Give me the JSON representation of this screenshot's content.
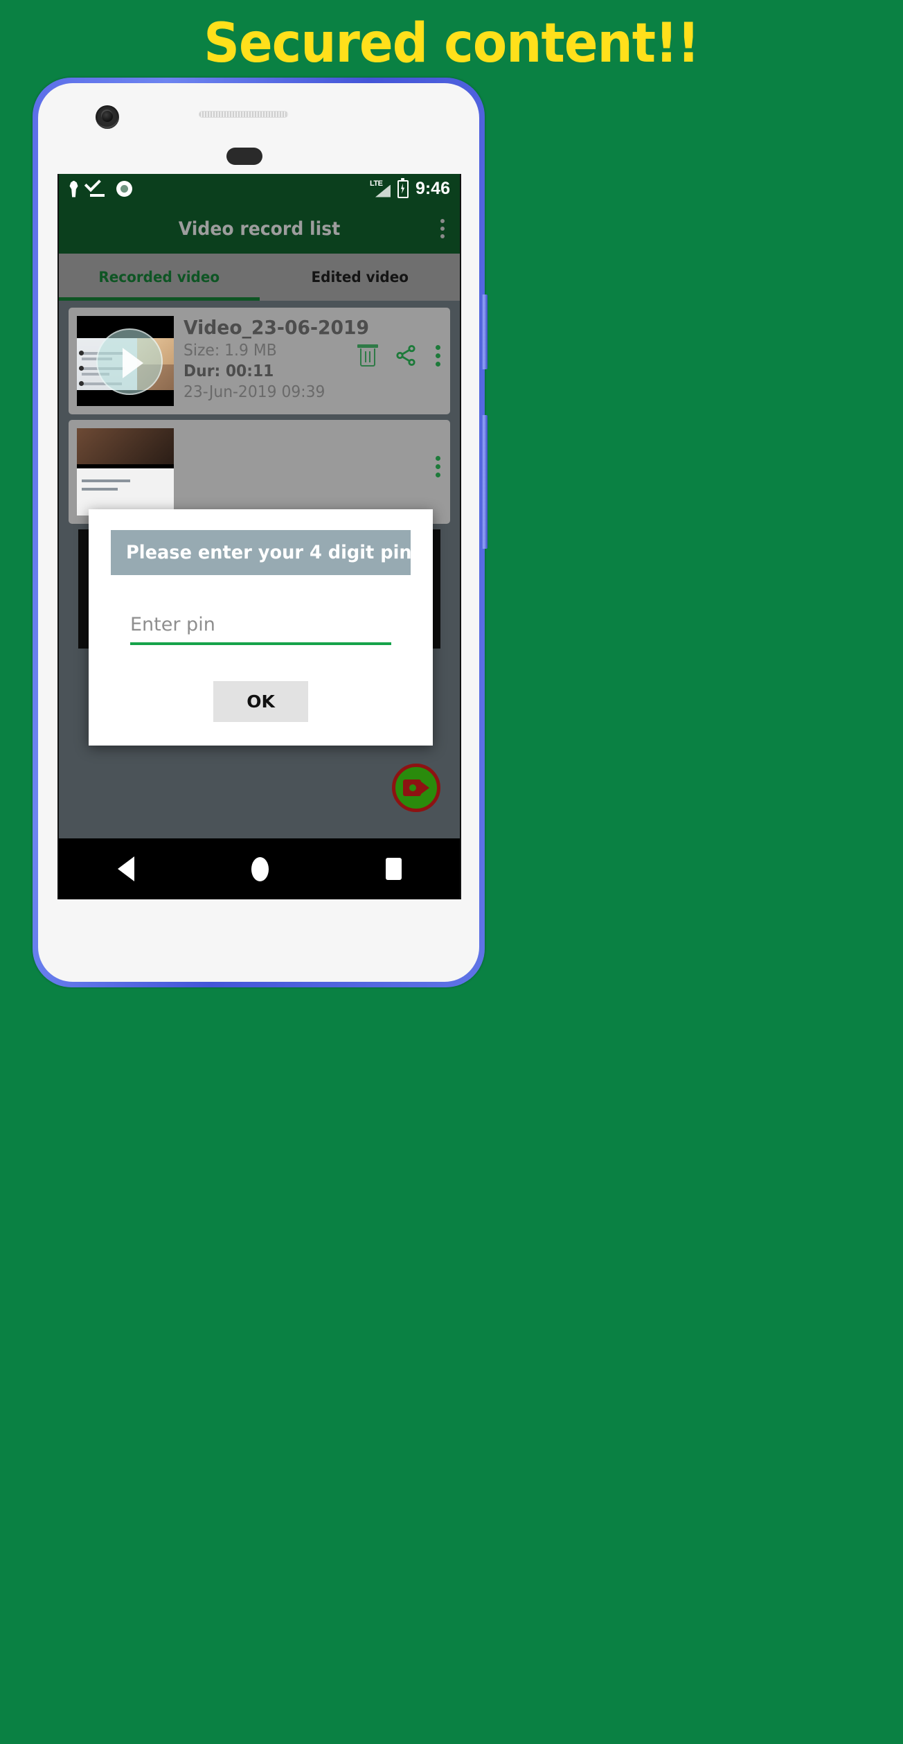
{
  "headline": "Secured content!!",
  "theme": {
    "background_green": "#0a8143",
    "headline_yellow": "#ffe01b",
    "appbar_green": "#0b3f1d",
    "accent_green": "#16a34a",
    "tab_active_green": "#0e5524",
    "dialog_banner": "#97aab2",
    "fab_green": "#2a8b0c",
    "fab_border_red": "#8e1212"
  },
  "statusbar": {
    "icons": [
      "key-icon",
      "check-underline-icon",
      "record-circle-icon"
    ],
    "network_label": "LTE",
    "network_icon": "signal-bars-icon",
    "battery_icon": "battery-charging-icon",
    "time": "9:46"
  },
  "appbar": {
    "title": "Video record list",
    "overflow_icon": "kebab-menu-icon"
  },
  "tabs": [
    {
      "label": "Recorded video",
      "active": true
    },
    {
      "label": "Edited video",
      "active": false
    }
  ],
  "videos": [
    {
      "name": "Video_23-06-2019",
      "size": "Size: 1.9 MB",
      "duration": "Dur: 00:11",
      "date": "23-Jun-2019 09:39",
      "actions": [
        "delete-icon",
        "share-icon",
        "kebab-menu-icon"
      ],
      "thumbnail": "video-thumbnail-play"
    }
  ],
  "fab": {
    "icon": "video-camera-icon"
  },
  "navbar": {
    "back": "back-triangle-icon",
    "home": "home-circle-icon",
    "recents": "recents-square-icon"
  },
  "dialog": {
    "banner_title": "Please enter your 4 digit pin",
    "input_value": "",
    "input_placeholder": "Enter pin",
    "ok_label": "OK"
  }
}
